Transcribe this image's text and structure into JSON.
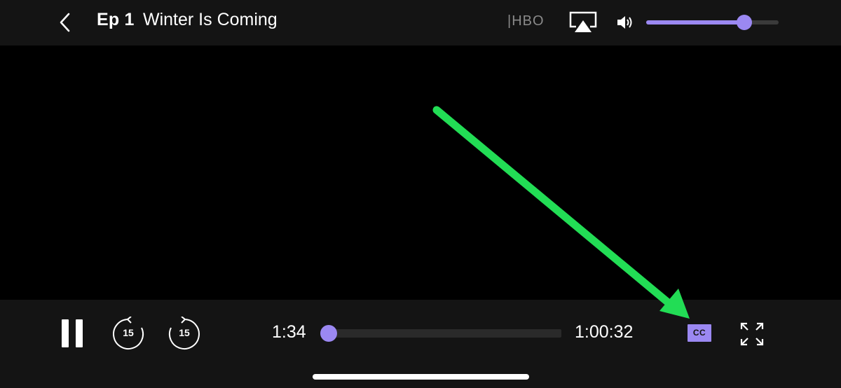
{
  "header": {
    "episode_label": "Ep 1",
    "episode_title": "Winter Is Coming",
    "network": "|HBO",
    "icons": {
      "back": "chevron-left-icon",
      "airplay": "airplay-icon",
      "volume": "volume-icon"
    }
  },
  "volume": {
    "level_fraction": 0.74
  },
  "player": {
    "elapsed_time": "1:34",
    "total_time": "1:00:32",
    "progress_fraction": 0.0,
    "skip_back_seconds": "15",
    "skip_forward_seconds": "15",
    "cc_label": "CC",
    "state_icon": "pause-icon",
    "fullscreen_icon": "fullscreen-icon"
  },
  "colors": {
    "accent": "#9b88f2",
    "bar_background": "#141414",
    "video_background": "#000000",
    "annotation_arrow": "#22dd55"
  }
}
